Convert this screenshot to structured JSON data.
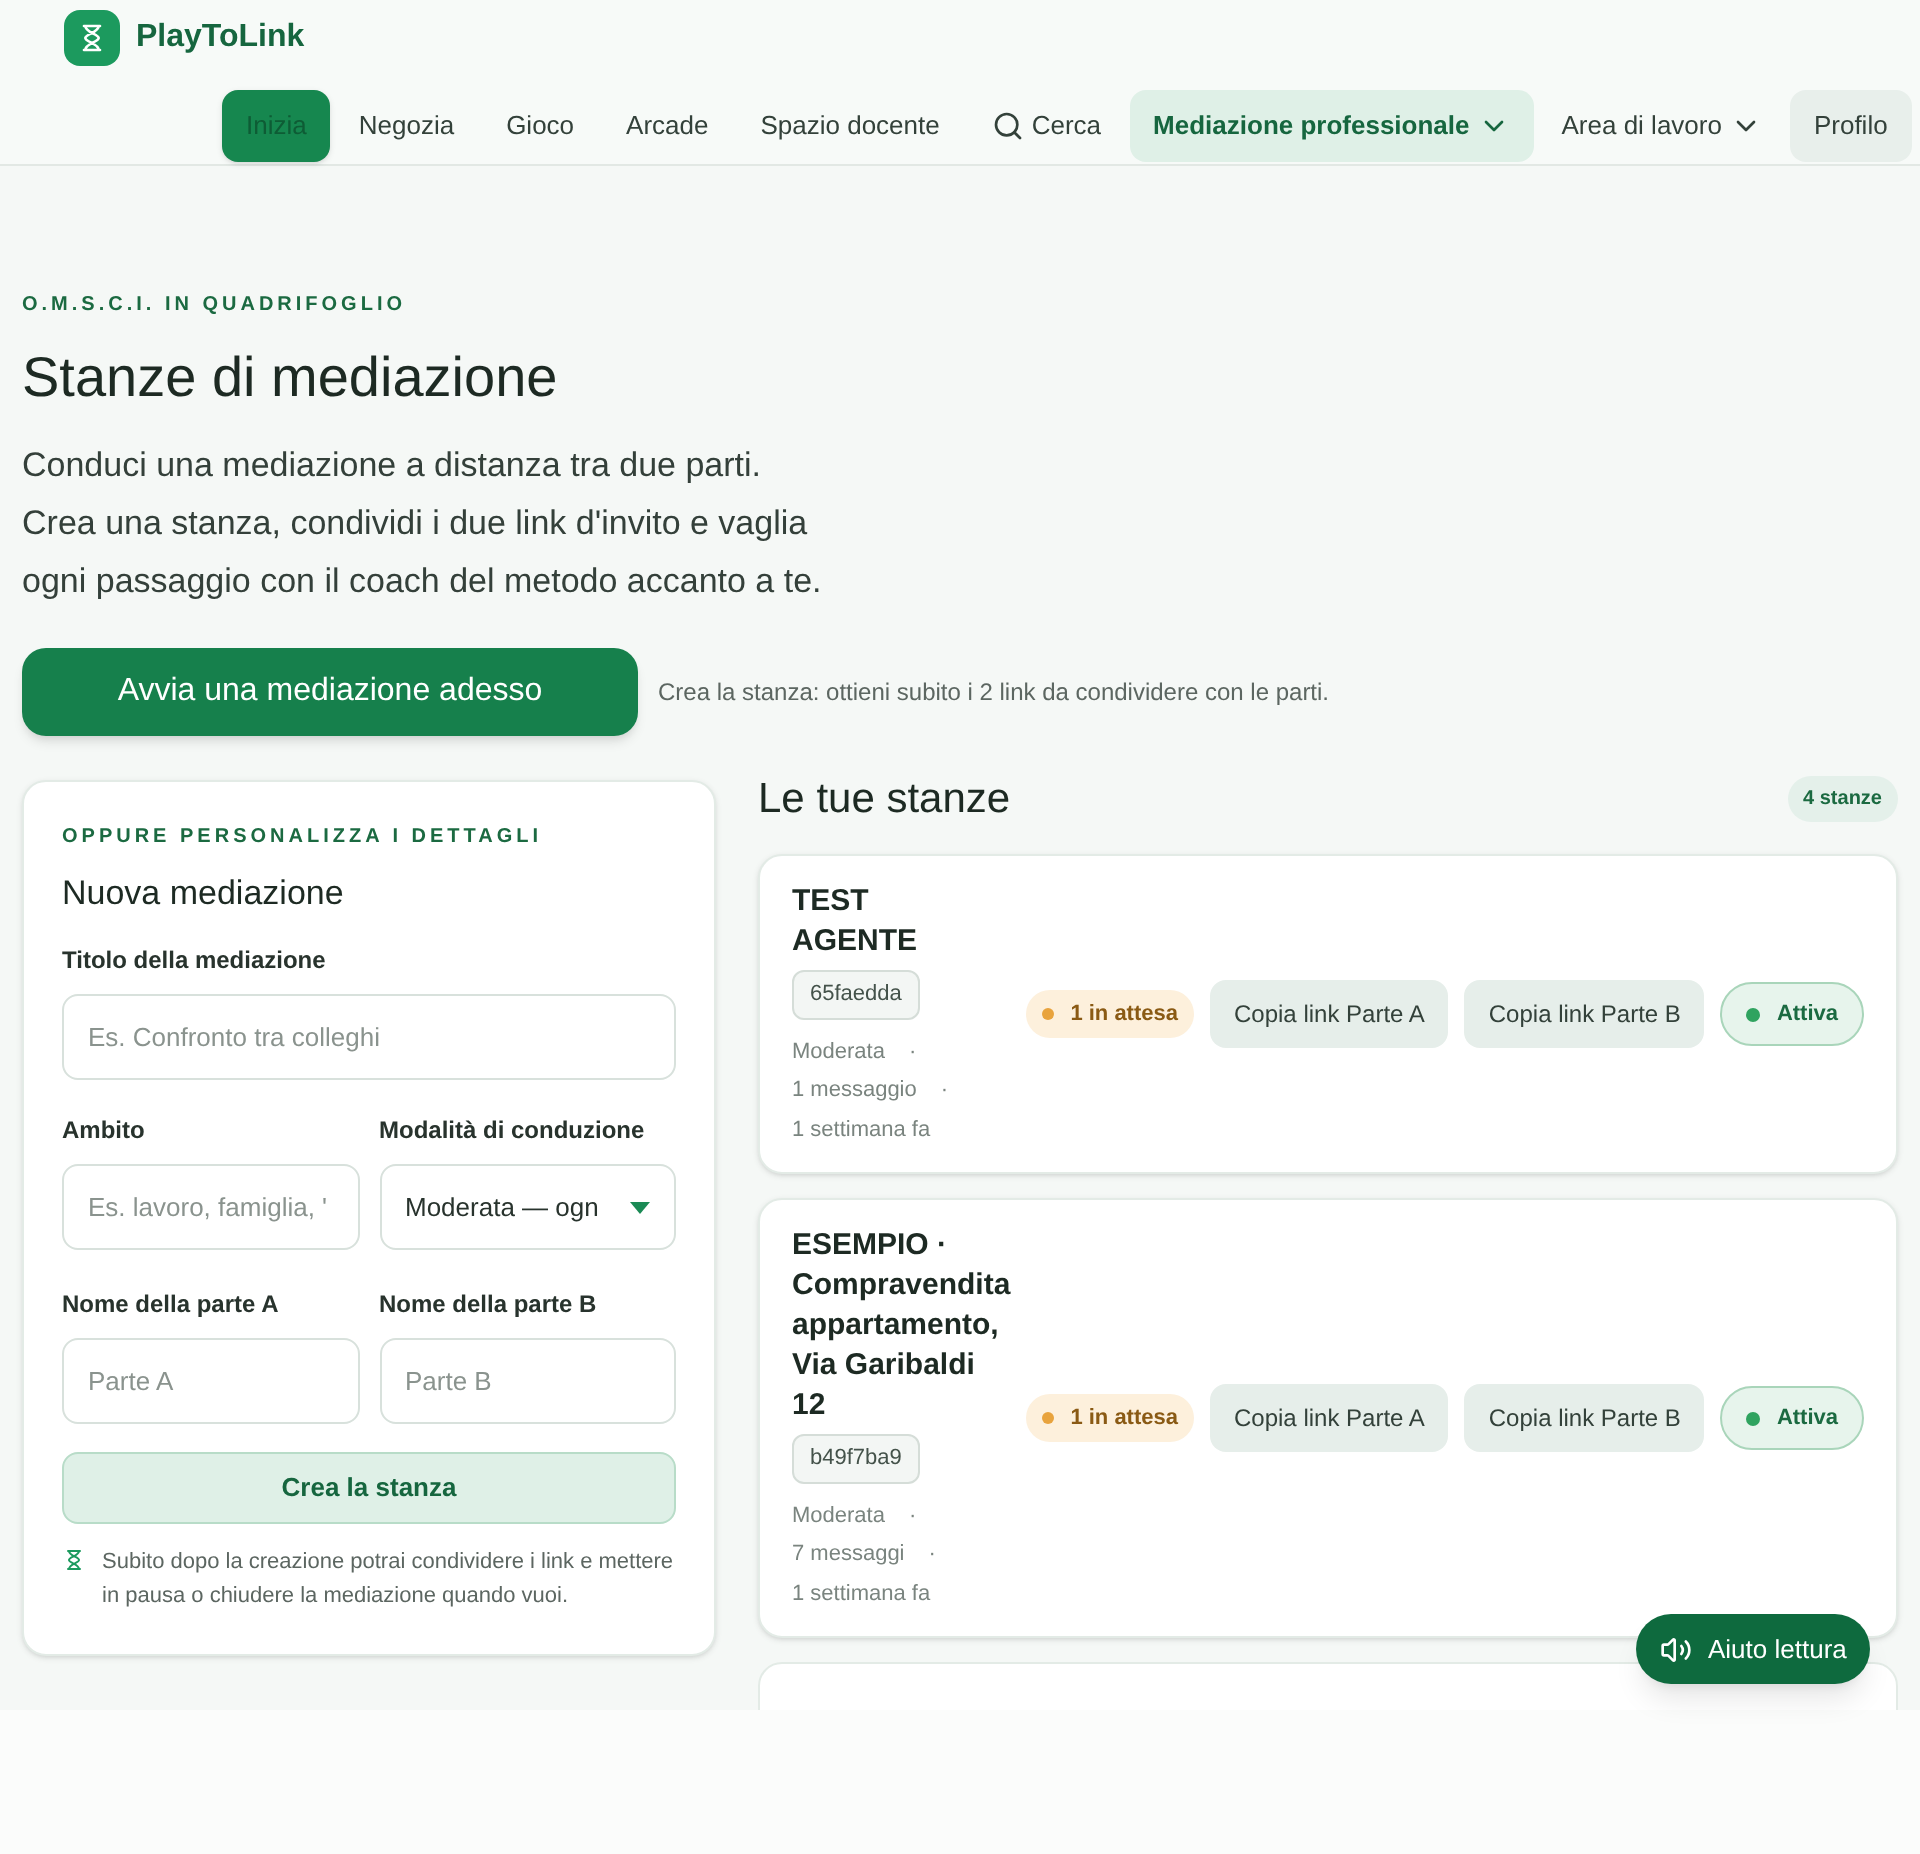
{
  "brand": {
    "name": "PlayToLink"
  },
  "nav": [
    {
      "label": "Inizia",
      "kind": "primary",
      "selected": true,
      "current": false
    },
    {
      "label": "Negozia",
      "kind": "link",
      "selected": false,
      "current": false
    },
    {
      "label": "Gioco",
      "kind": "link",
      "selected": false,
      "current": false
    },
    {
      "label": "Arcade",
      "kind": "link",
      "selected": false,
      "current": false
    },
    {
      "label": "Spazio docente",
      "kind": "link",
      "selected": false,
      "current": false
    },
    {
      "label": "Cerca",
      "kind": "search",
      "selected": false,
      "current": false
    },
    {
      "label": "Mediazione professionale",
      "kind": "menu",
      "selected": false,
      "current": true
    },
    {
      "label": "Area di lavoro",
      "kind": "menu",
      "selected": false,
      "current": false
    },
    {
      "label": "Profilo",
      "kind": "profile",
      "selected": false,
      "current": false
    }
  ],
  "hero": {
    "eyebrow": "O.M.S.C.I. IN QUADRIFOGLIO",
    "title": "Stanze di mediazione",
    "lines": [
      "Conduci una mediazione a distanza tra due parti.",
      "Crea una stanza, condividi i due link d'invito e vaglia",
      "ogni passaggio con il coach del metodo accanto a te."
    ],
    "cta": "Avvia una mediazione adesso",
    "cta_note": "Crea la stanza: ottieni subito i 2 link da condividere con le parti."
  },
  "form": {
    "eyebrow": "OPPURE PERSONALIZZA I DETTAGLI",
    "title": "Nuova mediazione",
    "title_field": {
      "label": "Titolo della mediazione",
      "placeholder": "Es. Confronto tra colleghi"
    },
    "scope_field": {
      "label": "Ambito",
      "placeholder": "Es. lavoro, famiglia, '"
    },
    "mode_field": {
      "label": "Modalità di conduzione",
      "value": "Moderata — ogn"
    },
    "party_a": {
      "label": "Nome della parte A",
      "placeholder": "Parte A"
    },
    "party_b": {
      "label": "Nome della parte B",
      "placeholder": "Parte B"
    },
    "submit": "Crea la stanza",
    "note": "Subito dopo la creazione potrai condividere i link e mettere in pausa o chiudere la mediazione quando vuoi."
  },
  "rooms": {
    "title": "Le tue stanze",
    "count": "4 stanze",
    "items": [
      {
        "title": "TEST AGENTE",
        "code": "65faedda",
        "meta": [
          {
            "text": "Moderata",
            "sep": "·"
          },
          {
            "text": "1 messaggio",
            "sep": "·"
          },
          {
            "text": "1 settimana fa"
          }
        ],
        "pending": "1 in attesa",
        "copy_a": "Copia link Parte A",
        "copy_b": "Copia link Parte B",
        "status": "Attiva",
        "active": true
      },
      {
        "title": "ESEMPIO · Compravendita appartamento, Via Garibaldi 12",
        "code": "b49f7ba9",
        "meta": [
          {
            "text": "Moderata",
            "sep": "·"
          },
          {
            "text": "7 messaggi",
            "sep": "·"
          },
          {
            "text": "1 settimana fa"
          }
        ],
        "pending": "1 in attesa",
        "copy_a": "Copia link Parte A",
        "copy_b": "Copia link Parte B",
        "status": "Attiva",
        "active": true
      }
    ]
  },
  "reading_help": "Aiuto lettura"
}
